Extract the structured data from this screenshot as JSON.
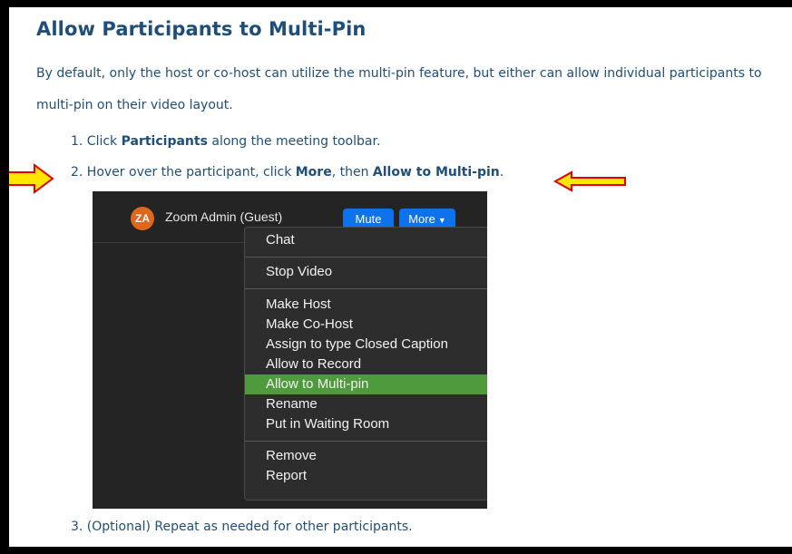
{
  "title": "Allow Participants to Multi-Pin",
  "intro": "By default, only the host or co-host can utilize the multi-pin feature, but either can allow individual participants to multi-pin on their video layout.",
  "steps": [
    {
      "prefix": "1. Click ",
      "bold1": "Participants",
      "mid": " along the meeting toolbar.",
      "bold2": "",
      "suffix": ""
    },
    {
      "prefix": "2. Hover over the participant, click ",
      "bold1": "More",
      "mid": ", then ",
      "bold2": "Allow to Multi-pin",
      "suffix": "."
    },
    {
      "prefix": "3. (Optional) Repeat as needed for other participants.",
      "bold1": "",
      "mid": "",
      "bold2": "",
      "suffix": ""
    }
  ],
  "screenshot": {
    "avatar_initials": "ZA",
    "participant_name": "Zoom Admin (Guest)",
    "mute_label": "Mute",
    "more_label": "More",
    "menu": [
      "Chat",
      "Stop Video",
      "Make Host",
      "Make Co-Host",
      "Assign to type Closed Caption",
      "Allow to Record",
      "Allow to Multi-pin",
      "Rename",
      "Put in Waiting Room",
      "Remove",
      "Report"
    ],
    "highlighted_item": "Allow to Multi-pin",
    "colors": {
      "button_blue": "#0e72ed",
      "highlight_green": "#4e9a3c",
      "avatar_orange": "#e0661b"
    }
  },
  "colors": {
    "heading": "#1f4e79",
    "arrow_fill": "#ffe600",
    "arrow_outline": "#e00000"
  }
}
